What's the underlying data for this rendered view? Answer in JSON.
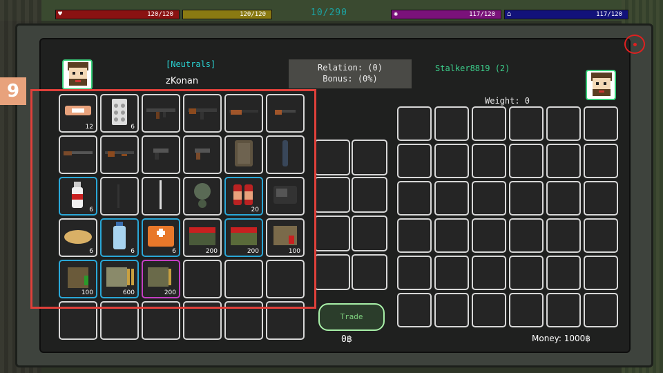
{
  "hud": {
    "counter": "10/290",
    "bars": [
      {
        "name": "health",
        "label": "120/120",
        "icon": "heart-icon",
        "glyph": "♥",
        "color": "#8a1212"
      },
      {
        "name": "hunger",
        "label": "120/120",
        "icon": "food-icon",
        "glyph": "",
        "color": "#8a7a12"
      },
      {
        "name": "mental",
        "label": "117/120",
        "icon": "brain-icon",
        "glyph": "✺",
        "color": "#7a127a"
      },
      {
        "name": "stamina",
        "label": "117/120",
        "icon": "water-icon",
        "glyph": "⌂",
        "color": "#12127a"
      }
    ]
  },
  "player": {
    "faction": "[Neutrals]",
    "name": "zKonan"
  },
  "relation": {
    "line1": "Relation: (0)",
    "line2": "Bonus: (0%)"
  },
  "trader": {
    "name": "Stalker8819 (2)",
    "weight": "Weight: 0",
    "money": "Money: 1000฿"
  },
  "trade": {
    "button_label": "Trade",
    "offer_money": "0฿"
  },
  "highlight_badge": "9",
  "inventory": [
    {
      "item": "bandage",
      "qty": "12",
      "rarity": "common"
    },
    {
      "item": "pills",
      "qty": "6",
      "rarity": "common"
    },
    {
      "item": "assault-rifle",
      "qty": "",
      "rarity": "common"
    },
    {
      "item": "assault-rifle-ak",
      "qty": "",
      "rarity": "common"
    },
    {
      "item": "hunting-rifle",
      "qty": "",
      "rarity": "common"
    },
    {
      "item": "sawed-off-shotgun",
      "qty": "",
      "rarity": "common"
    },
    {
      "item": "shotgun",
      "qty": "",
      "rarity": "common"
    },
    {
      "item": "pump-shotgun",
      "qty": "",
      "rarity": "common"
    },
    {
      "item": "pistol",
      "qty": "",
      "rarity": "common"
    },
    {
      "item": "pistol-brown",
      "qty": "",
      "rarity": "common"
    },
    {
      "item": "backpack",
      "qty": "",
      "rarity": "common"
    },
    {
      "item": "knife",
      "qty": "",
      "rarity": "common"
    },
    {
      "item": "vodka",
      "qty": "6",
      "rarity": "rare"
    },
    {
      "item": "antenna",
      "qty": "",
      "rarity": "common"
    },
    {
      "item": "rod",
      "qty": "",
      "rarity": "common"
    },
    {
      "item": "gas-mask",
      "qty": "",
      "rarity": "common"
    },
    {
      "item": "batteries",
      "qty": "20",
      "rarity": "rare"
    },
    {
      "item": "radio",
      "qty": "",
      "rarity": "common"
    },
    {
      "item": "bread",
      "qty": "6",
      "rarity": "common"
    },
    {
      "item": "water-bottle",
      "qty": "6",
      "rarity": "rare"
    },
    {
      "item": "first-aid-kit",
      "qty": "6",
      "rarity": "rare"
    },
    {
      "item": "ammo-box-red",
      "qty": "200",
      "rarity": "common"
    },
    {
      "item": "ammo-box-green",
      "qty": "200",
      "rarity": "rare"
    },
    {
      "item": "shotgun-shells",
      "qty": "100",
      "rarity": "common"
    },
    {
      "item": "ammo-box-small",
      "qty": "100",
      "rarity": "rare"
    },
    {
      "item": "rifle-ammo",
      "qty": "600",
      "rarity": "rare"
    },
    {
      "item": "ammo-crate",
      "qty": "200",
      "rarity": "epic"
    },
    {
      "item": "",
      "qty": "",
      "rarity": "empty"
    },
    {
      "item": "",
      "qty": "",
      "rarity": "empty"
    },
    {
      "item": "",
      "qty": "",
      "rarity": "empty"
    },
    {
      "item": "",
      "qty": "",
      "rarity": "empty"
    },
    {
      "item": "",
      "qty": "",
      "rarity": "empty"
    },
    {
      "item": "",
      "qty": "",
      "rarity": "empty"
    },
    {
      "item": "",
      "qty": "",
      "rarity": "empty"
    },
    {
      "item": "",
      "qty": "",
      "rarity": "empty"
    },
    {
      "item": "",
      "qty": "",
      "rarity": "empty"
    }
  ],
  "colors": {
    "rare": "#2aa8d8",
    "epic": "#c43fc4",
    "accent_green": "#37d07a",
    "faction_cyan": "#2ad2d2",
    "close_red": "#e02020"
  }
}
